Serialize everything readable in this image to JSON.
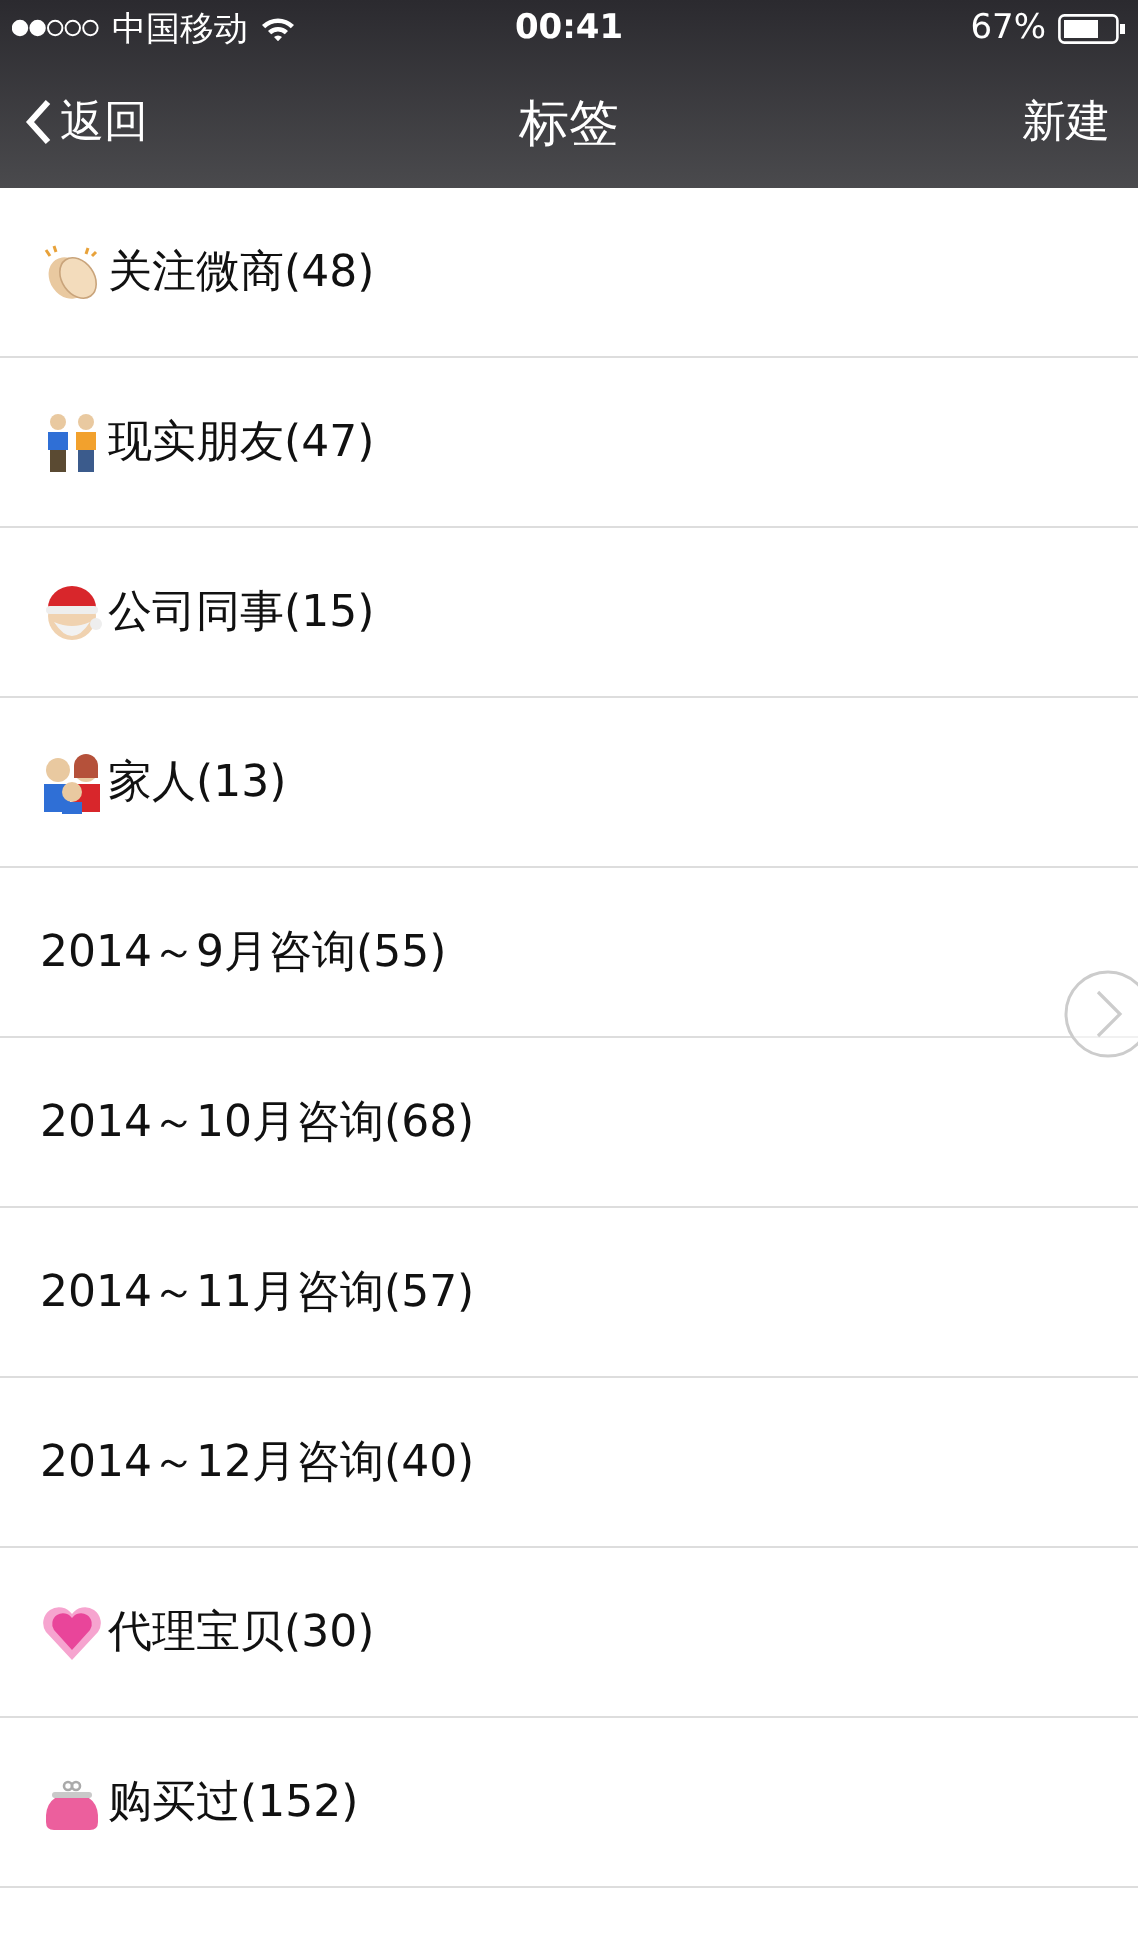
{
  "status_bar": {
    "carrier": "中国移动",
    "time": "00:41",
    "battery": "67%"
  },
  "nav": {
    "back": "返回",
    "title": "标签",
    "action": "新建"
  },
  "tags": [
    {
      "kind": "clap",
      "label": "关注微商(48)"
    },
    {
      "kind": "friends",
      "label": "现实朋友(47)"
    },
    {
      "kind": "santa",
      "label": "公司同事(15)"
    },
    {
      "kind": "family",
      "label": "家人(13)"
    },
    {
      "kind": "plain",
      "label": "2014～9月咨询(55)"
    },
    {
      "kind": "plain",
      "label": "2014～10月咨询(68)"
    },
    {
      "kind": "plain",
      "label": "2014～11月咨询(57)"
    },
    {
      "kind": "plain",
      "label": "2014～12月咨询(40)"
    },
    {
      "kind": "heart",
      "label": "代理宝贝(30)"
    },
    {
      "kind": "purse",
      "label": "购买过(152)"
    }
  ]
}
